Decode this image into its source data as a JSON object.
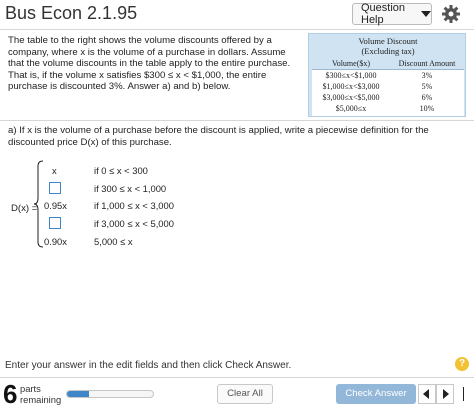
{
  "header": {
    "title": "Bus Econ 2.1.95",
    "help_label": "Question Help"
  },
  "intro": {
    "text": "The table to the right shows the volume discounts offered by a company, where x is the volume of a purchase in dollars. Assume that the volume discounts in the table apply to the entire purchase. That is, if the volume x satisfies $300 ≤ x < $1,000, the entire purchase is discounted 3%. Answer a) and b) below."
  },
  "discount_table": {
    "caption_line1": "Volume Discount",
    "caption_line2": "(Excluding tax)",
    "col_volume": "Volume($x)",
    "col_amount": "Discount Amount",
    "rows": [
      {
        "volume": "$300≤x<$1,000",
        "amount": "3%"
      },
      {
        "volume": "$1,000≤x<$3,000",
        "amount": "5%"
      },
      {
        "volume": "$3,000≤x<$5,000",
        "amount": "6%"
      },
      {
        "volume": "$5,000≤x",
        "amount": "10%"
      }
    ]
  },
  "question_a": {
    "text": "a) If x is the volume of a purchase before the discount is applied, write a piecewise definition for the discounted price D(x) of this purchase."
  },
  "piecewise": {
    "lhs": "D(x) =",
    "rows": [
      {
        "expr": "x",
        "has_box": false,
        "cond": "if 0 ≤ x < 300"
      },
      {
        "expr": "",
        "has_box": true,
        "cond": "if 300 ≤ x < 1,000"
      },
      {
        "expr": "0.95x",
        "has_box": false,
        "cond": "if 1,000 ≤ x < 3,000"
      },
      {
        "expr": "",
        "has_box": true,
        "cond": "if 3,000 ≤ x < 5,000"
      },
      {
        "expr": "0.90x",
        "has_box": false,
        "cond": "5,000 ≤ x"
      }
    ]
  },
  "footer": {
    "instruction": "Enter your answer in the edit fields and then click Check Answer.",
    "help_icon": "?",
    "parts_count": "6",
    "parts_line1": "parts",
    "parts_line2": "remaining",
    "progress": 0.25,
    "clear_all": "Clear All",
    "check_answer": "Check Answer"
  },
  "colors": {
    "accent": "#3f86c8",
    "check_button": "#93b7d9",
    "table_bg": "#cfe3f2",
    "help_icon": "#f3c234"
  }
}
